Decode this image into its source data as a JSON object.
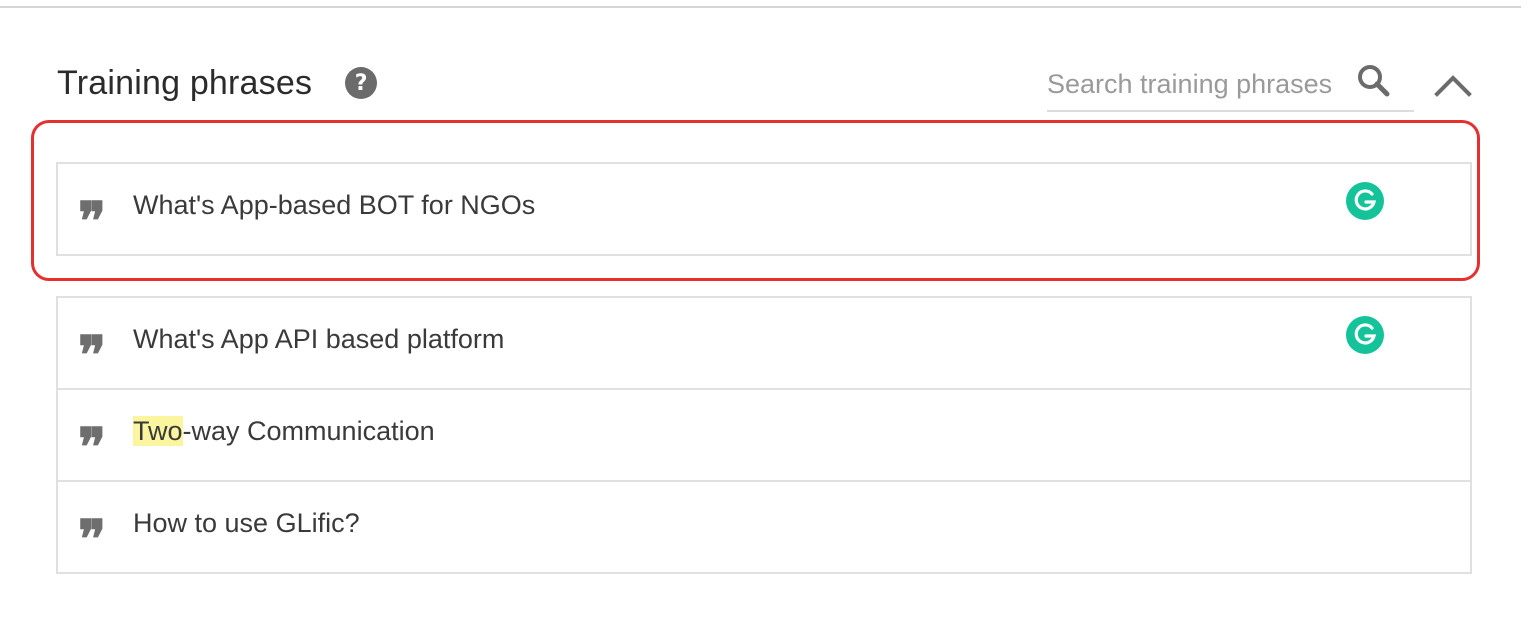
{
  "section": {
    "title": "Training phrases",
    "help_icon": "help-circle-icon"
  },
  "search": {
    "placeholder": "Search training phrases",
    "icon": "search-icon"
  },
  "collapse": {
    "icon": "chevron-up-icon"
  },
  "colors": {
    "highlight_border": "#e53030",
    "grammarly": "#15c39a",
    "text_highlight": "#fbf59f"
  },
  "phrases": [
    {
      "text": "What's App-based BOT for NGOs",
      "grammarly": true
    },
    {
      "text": "What's App API based platform",
      "grammarly": true
    },
    {
      "highlight": "Two",
      "rest": "-way Communication",
      "grammarly": false
    },
    {
      "text": "How to use GLific?",
      "grammarly": false
    }
  ]
}
